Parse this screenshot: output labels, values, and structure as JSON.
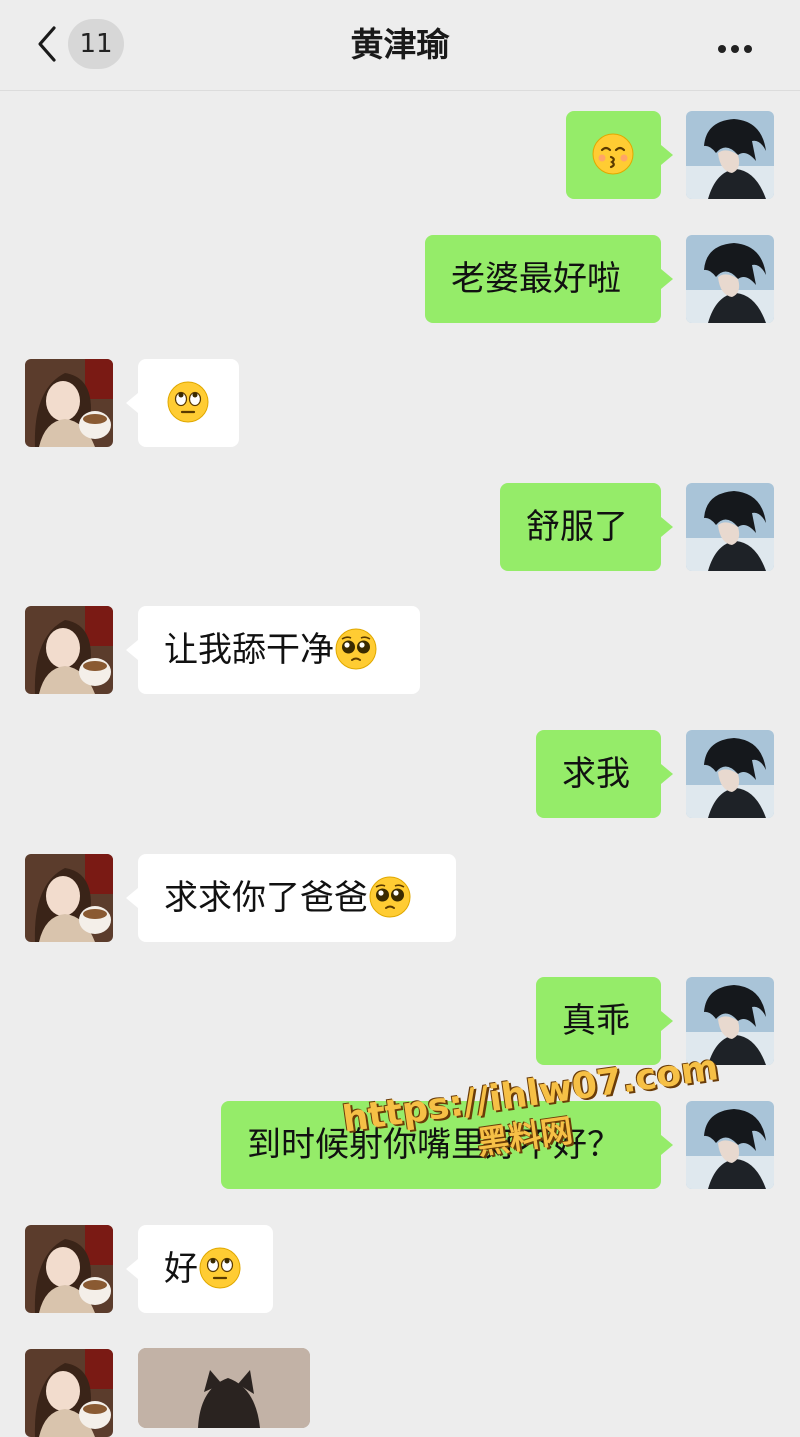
{
  "header": {
    "unread_count": "11",
    "title": "黄津瑜"
  },
  "messages": [
    {
      "side": "out",
      "text": "",
      "emoji": "kissing-face"
    },
    {
      "side": "out",
      "text": "老婆最好啦"
    },
    {
      "side": "in",
      "text": "",
      "emoji": "eye-roll-face"
    },
    {
      "side": "out",
      "text": "舒服了"
    },
    {
      "side": "in",
      "text": "让我舔干净",
      "emoji": "pleading-face"
    },
    {
      "side": "out",
      "text": "求我"
    },
    {
      "side": "in",
      "text": "求求你了爸爸",
      "emoji": "pleading-face"
    },
    {
      "side": "out",
      "text": "真乖"
    },
    {
      "side": "out",
      "text": "到时候射你嘴里好不好？"
    },
    {
      "side": "in",
      "text": "好",
      "emoji": "eye-roll-face"
    },
    {
      "side": "in",
      "type": "image",
      "text": ""
    }
  ],
  "watermark": {
    "url": "https://ihlw07.com",
    "name": "黑料网"
  },
  "colors": {
    "background": "#ededed",
    "outgoing_bubble": "#95ec69",
    "incoming_bubble": "#ffffff"
  }
}
